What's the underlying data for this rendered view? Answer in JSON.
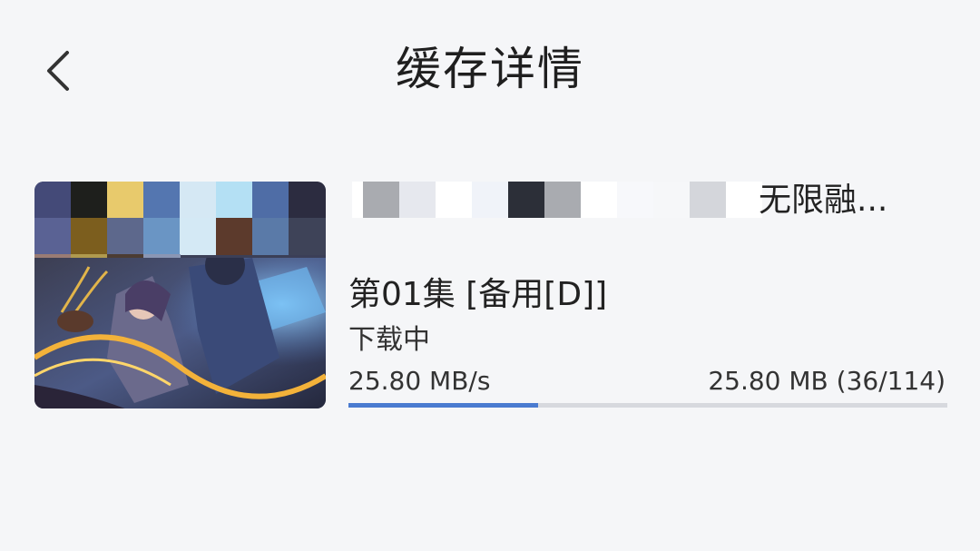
{
  "header": {
    "title": "缓存详情",
    "back_icon": "chevron-left-icon"
  },
  "download_item": {
    "title_suffix": "无限融...",
    "episode": "第01集 [备用[D]]",
    "status": "下载中",
    "speed": "25.80 MB/s",
    "size_progress": "25.80 MB (36/114)",
    "progress_fraction": 0.316
  },
  "colors": {
    "background": "#f5f6f8",
    "accent": "#4a7bd0",
    "progress_track": "#d7d9de"
  }
}
